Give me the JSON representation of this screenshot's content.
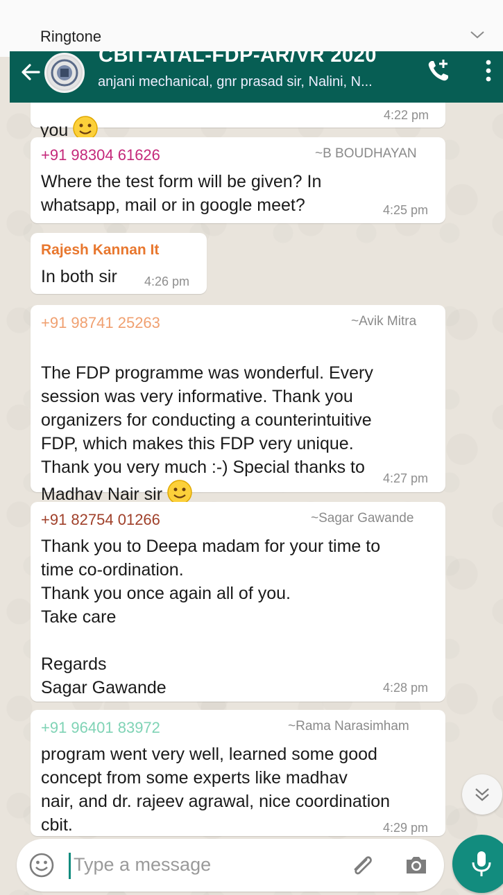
{
  "notification": {
    "label": "Ringtone"
  },
  "header": {
    "title": "CBIT-ATAL-FDP-AR/VR 2020",
    "members": "anjani mechanical, gnr prasad sir, Nalini, N..."
  },
  "messages": [
    {
      "text": "you",
      "time": "4:22 pm"
    },
    {
      "phone": "+91 98304 61626",
      "phone_color": "#c4287a",
      "name": "~B BOUDHAYAN",
      "text": "Where the test form will be given? In\nwhatsapp, mail or in google meet?",
      "time": "4:25 pm"
    },
    {
      "name": "Rajesh Kannan It",
      "name_color": "#e8772e",
      "text": "In both sir",
      "time": "4:26 pm"
    },
    {
      "phone": "+91 98741 25263",
      "phone_color": "#f0a070",
      "name": "~Avik Mitra",
      "text": "The FDP programme was wonderful. Every\nsession was very informative. Thank you\norganizers for conducting a counterintuitive\nFDP, which makes this FDP very unique.\nThank you very much :-) Special thanks to\nMadhav Nair sir",
      "time": "4:27 pm"
    },
    {
      "phone": "+91 82754 01266",
      "phone_color": "#a0402a",
      "name": "~Sagar Gawande",
      "text": "Thank you to Deepa madam for your time to\ntime co-ordination.\n Thank you once again all of you.\nTake care\n\nRegards\nSagar Gawande",
      "time": "4:28 pm"
    },
    {
      "phone": "+91 96401 83972",
      "phone_color": "#7fd3b5",
      "name": "~Rama Narasimham",
      "text": "program went very well, learned some good\nconcept from some experts like madhav\nnair, and dr. rajeev agrawal, nice coordination\ncbit.",
      "time": "4:29 pm"
    }
  ],
  "composer": {
    "placeholder": "Type a message"
  },
  "colors": {
    "header": "#075e54",
    "accent": "#128c7e"
  },
  "icons": [
    "chevron-down-icon",
    "back-arrow-icon",
    "group-avatar",
    "add-call-icon",
    "more-vert-icon",
    "smiley-emoji-icon",
    "emoji-icon",
    "attach-icon",
    "camera-icon",
    "mic-icon",
    "scroll-down-icon"
  ]
}
